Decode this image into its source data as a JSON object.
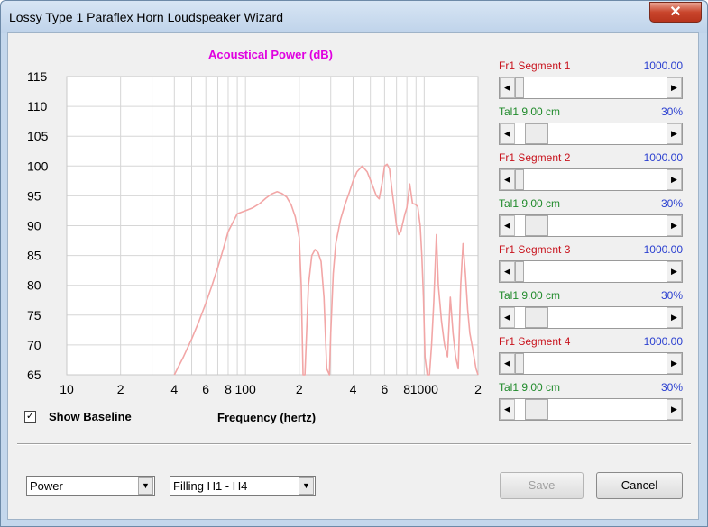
{
  "window": {
    "title": "Lossy Type 1 Paraflex Horn Loudspeaker Wizard",
    "close_glyph": "✕"
  },
  "checkbox": {
    "show_baseline_label": "Show Baseline",
    "checked": true,
    "check_glyph": "✓"
  },
  "chart_data": {
    "type": "line",
    "title": "Acoustical Power (dB)",
    "xlabel": "Frequency (hertz)",
    "ylabel": "",
    "x_scale": "log",
    "xlim": [
      10,
      2000
    ],
    "ylim": [
      65,
      115
    ],
    "yticks": [
      "115",
      "110",
      "105",
      "100",
      "95",
      "90",
      "85",
      "80",
      "75",
      "70",
      "65"
    ],
    "xticks": [
      {
        "value": 10,
        "label": "10"
      },
      {
        "value": 20,
        "label": "2"
      },
      {
        "value": 40,
        "label": "4"
      },
      {
        "value": 60,
        "label": "6"
      },
      {
        "value": 80,
        "label": "8"
      },
      {
        "value": 100,
        "label": "100"
      },
      {
        "value": 200,
        "label": "2"
      },
      {
        "value": 400,
        "label": "4"
      },
      {
        "value": 600,
        "label": "6"
      },
      {
        "value": 800,
        "label": "8"
      },
      {
        "value": 1000,
        "label": "1000"
      },
      {
        "value": 2000,
        "label": "2"
      }
    ],
    "grid": true,
    "color": "#f2a6a6",
    "series": [
      {
        "x": [
          40,
          45,
          50,
          55,
          60,
          65,
          70,
          75,
          80,
          90,
          100,
          110,
          120,
          130,
          140,
          150,
          160,
          170,
          180,
          190,
          200,
          205,
          210,
          215,
          225,
          235,
          245,
          255,
          265,
          275,
          285,
          295,
          300,
          310,
          320,
          340,
          360,
          380,
          400,
          420,
          450,
          480,
          510,
          540,
          560,
          580,
          600,
          620,
          640,
          660,
          680,
          700,
          720,
          740,
          760,
          780,
          800,
          830,
          860,
          890,
          920,
          950,
          970,
          990,
          1010,
          1040,
          1070,
          1100,
          1130,
          1170,
          1200,
          1250,
          1300,
          1350,
          1400,
          1450,
          1500,
          1550,
          1600,
          1650,
          1700,
          1750,
          1800,
          1850,
          1900,
          1950,
          2000
        ],
        "y": [
          65,
          68,
          71,
          74,
          77,
          80,
          83,
          86,
          89,
          92,
          92.5,
          93,
          93.7,
          94.6,
          95.3,
          95.7,
          95.4,
          94.8,
          93.5,
          91.5,
          88,
          80,
          65,
          65,
          80,
          85,
          86,
          85.5,
          84,
          78,
          66,
          65,
          72,
          82,
          87,
          91,
          93.5,
          95.5,
          97.5,
          99,
          100,
          99,
          97,
          95,
          94.5,
          97,
          100,
          100.3,
          99.5,
          96,
          93,
          90,
          88.5,
          89,
          90.5,
          92,
          93,
          97,
          93.7,
          93.6,
          93.2,
          90,
          85,
          78,
          68,
          65,
          65,
          70,
          77,
          88.5,
          80,
          74,
          70,
          68,
          78,
          72,
          68,
          66,
          80,
          87,
          82,
          76,
          72,
          70,
          68,
          66,
          65
        ]
      }
    ]
  },
  "panel": {
    "rows": [
      {
        "type": "label",
        "left": "Fr1  Segment 1",
        "right": "1000.00",
        "color": "red"
      },
      {
        "type": "scroll",
        "level": 0
      },
      {
        "type": "label",
        "left": "Tal1  9.00 cm",
        "right": "30%",
        "color": "green"
      },
      {
        "type": "scroll",
        "level": 0.08
      },
      {
        "type": "label",
        "left": "Fr1  Segment 2",
        "right": "1000.00",
        "color": "red"
      },
      {
        "type": "scroll",
        "level": 0
      },
      {
        "type": "label",
        "left": "Tal1  9.00 cm",
        "right": "30%",
        "color": "green"
      },
      {
        "type": "scroll",
        "level": 0.08
      },
      {
        "type": "label",
        "left": "Fr1  Segment 3",
        "right": "1000.00",
        "color": "red"
      },
      {
        "type": "scroll",
        "level": 0
      },
      {
        "type": "label",
        "left": "Tal1  9.00 cm",
        "right": "30%",
        "color": "green"
      },
      {
        "type": "scroll",
        "level": 0.08
      },
      {
        "type": "label",
        "left": "Fr1  Segment 4",
        "right": "1000.00",
        "color": "red"
      },
      {
        "type": "scroll",
        "level": 0
      },
      {
        "type": "label",
        "left": "Tal1  9.00 cm",
        "right": "30%",
        "color": "green"
      },
      {
        "type": "scroll",
        "level": 0.08
      }
    ],
    "arrow_left": "◀",
    "arrow_right": "▶"
  },
  "footer": {
    "select_power": "Power",
    "select_filling": "Filling H1 - H4",
    "select_arrow": "▼",
    "save_label": "Save",
    "cancel_label": "Cancel"
  }
}
